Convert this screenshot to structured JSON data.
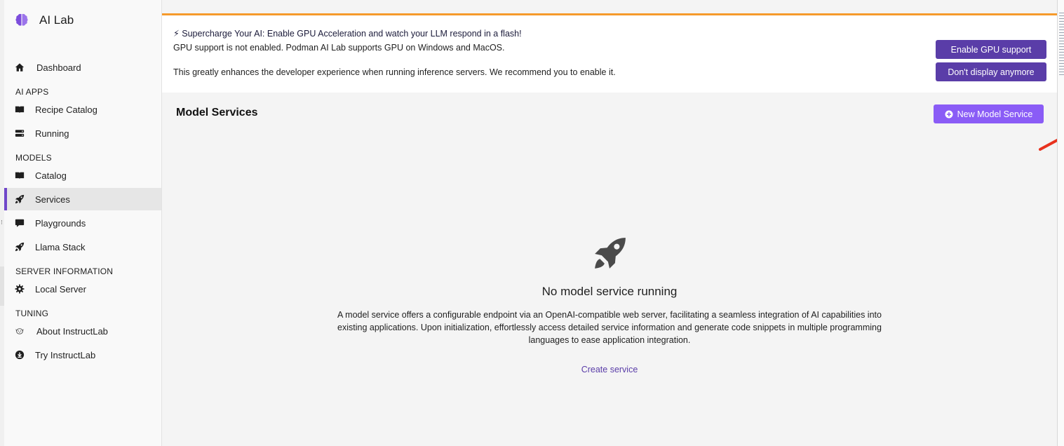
{
  "app": {
    "name": "AI Lab"
  },
  "sidebar": {
    "dashboard": "Dashboard",
    "sections": {
      "ai_apps": "AI APPS",
      "models": "MODELS",
      "server_information": "SERVER INFORMATION",
      "tuning": "TUNING"
    },
    "items": {
      "recipe_catalog": "Recipe Catalog",
      "running": "Running",
      "catalog": "Catalog",
      "services": "Services",
      "playgrounds": "Playgrounds",
      "llama_stack": "Llama Stack",
      "local_server": "Local Server",
      "about_instructlab": "About InstructLab",
      "try_instructlab": "Try InstructLab"
    },
    "active_item": "Services"
  },
  "banner": {
    "headline": "⚡ Supercharge Your AI: Enable GPU Acceleration and watch your LLM respond in a flash!",
    "line1": "GPU support is not enabled. Podman AI Lab supports GPU on Windows and MacOS.",
    "line2": "This greatly enhances the developer experience when running inference servers. We recommend you to enable it.",
    "enable_button": "Enable GPU support",
    "dismiss_button": "Don't display anymore"
  },
  "page": {
    "title": "Model Services",
    "new_button": "New Model Service"
  },
  "empty_state": {
    "title": "No model service running",
    "description": "A model service offers a configurable endpoint via an OpenAI-compatible web server, facilitating a seamless integration of AI capabilities into existing applications. Upon initialization, effortlessly access detailed service information and generate code snippets in multiple programming languages to ease application integration.",
    "link": "Create service"
  },
  "colors": {
    "accent_purple": "#5a3da8",
    "button_purple": "#8a5cf6",
    "banner_border": "#f59a2b",
    "annotation_arrow": "#e8321e"
  },
  "icons": {
    "brand": "brain-icon",
    "dashboard": "home-icon",
    "recipe_catalog": "book-open-icon",
    "running": "server-icon",
    "catalog": "book-open-icon",
    "services": "rocket-icon",
    "playgrounds": "comment-icon",
    "llama_stack": "rocket-icon",
    "local_server": "gear-icon",
    "about_instructlab": "instructlab-dog-icon",
    "try_instructlab": "download-circle-icon",
    "new_model_service": "plus-circle-icon",
    "empty_state": "rocket-icon"
  }
}
